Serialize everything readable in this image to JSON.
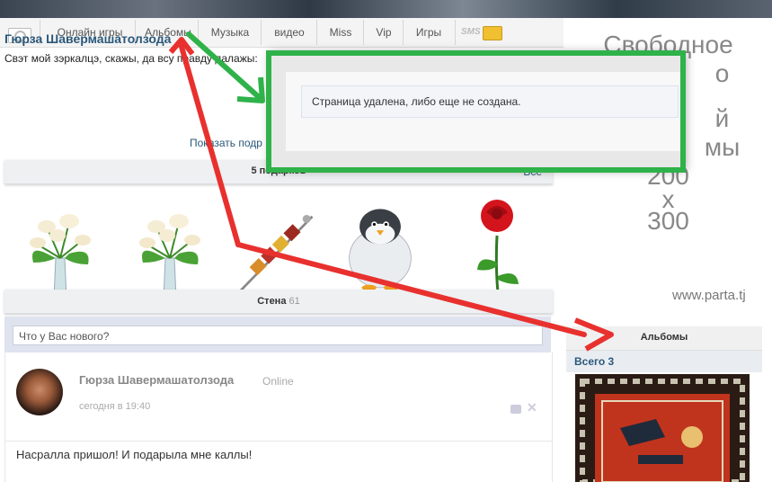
{
  "nav": {
    "items": [
      "Онлайн игры",
      "Альбомы",
      "Музыка",
      "видео",
      "Miss",
      "Vip",
      "Игры"
    ],
    "sms_label": "SMS"
  },
  "profile": {
    "name": "Гюрза Шавермашатолзода",
    "status": "Свэт мой зэркалцэ, скажы, да всу правду далажы:",
    "show_link": "Показать подр"
  },
  "gifts": {
    "title": "5 подарков",
    "all_link": "Все",
    "items": [
      "lily-gift-icon",
      "lily-gift-icon",
      "kebab-gift-icon",
      "penguin-gift-icon",
      "rose-gift-icon"
    ]
  },
  "wall": {
    "title": "Стена",
    "count": "61",
    "compose_placeholder": "Что у Вас нового?",
    "post": {
      "author": "Гюрза Шавермашатолзода",
      "online": "Online",
      "time": "сегодня в 19:40",
      "text": "Насралла пришол! И подарыла мне каллы!"
    }
  },
  "ad": {
    "lines": [
      "Свободное",
      "о",
      "й",
      "мы",
      "200",
      "x",
      "300"
    ],
    "domain": "www.parta.tj"
  },
  "albums": {
    "title": "Альбомы",
    "total": "Всего 3"
  },
  "dialog": {
    "message": "Страница удалена, либо еще не создана."
  },
  "colors": {
    "link": "#2b587a",
    "highlight": "#2fb24a",
    "arrow": "#e8312e"
  }
}
